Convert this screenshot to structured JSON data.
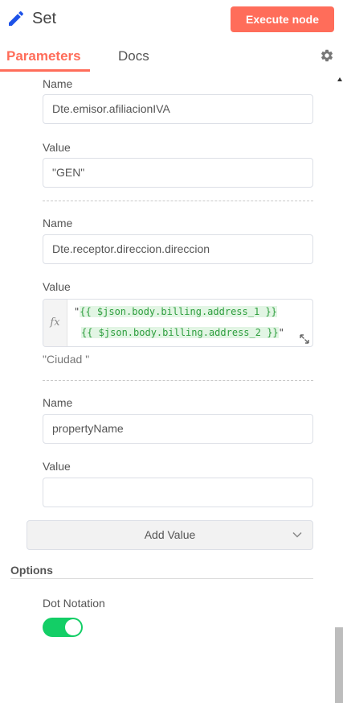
{
  "header": {
    "title": "Set",
    "title_icon": "pencil-icon",
    "execute_label": "Execute node"
  },
  "tabs": {
    "parameters": "Parameters",
    "docs": "Docs",
    "settings_icon": "gear-icon"
  },
  "values": [
    {
      "name_label": "Name",
      "name_value": "Dte.emisor.afiliacionIVA",
      "value_label": "Value",
      "value_value": "\"GEN\""
    },
    {
      "name_label": "Name",
      "name_value": "Dte.receptor.direccion.direccion",
      "value_label": "Value",
      "expression": {
        "fx_label": "fx",
        "line1_quote": "\"",
        "line1_code": "{{ $json.body.billing.address_1 }}",
        "line2_code": "{{ $json.body.billing.address_2 }}",
        "line2_tail": "\"",
        "continuation": "\"Ciudad  \""
      }
    },
    {
      "name_label": "Name",
      "name_value": "propertyName",
      "value_label": "Value",
      "value_value": ""
    }
  ],
  "add_value_label": "Add Value",
  "options": {
    "title": "Options",
    "dot_notation_label": "Dot Notation",
    "dot_notation_enabled": true
  },
  "colors": {
    "accent": "#ff6d5a",
    "toggle_on": "#13ce66",
    "expression_highlight": "#e2f5e4"
  }
}
